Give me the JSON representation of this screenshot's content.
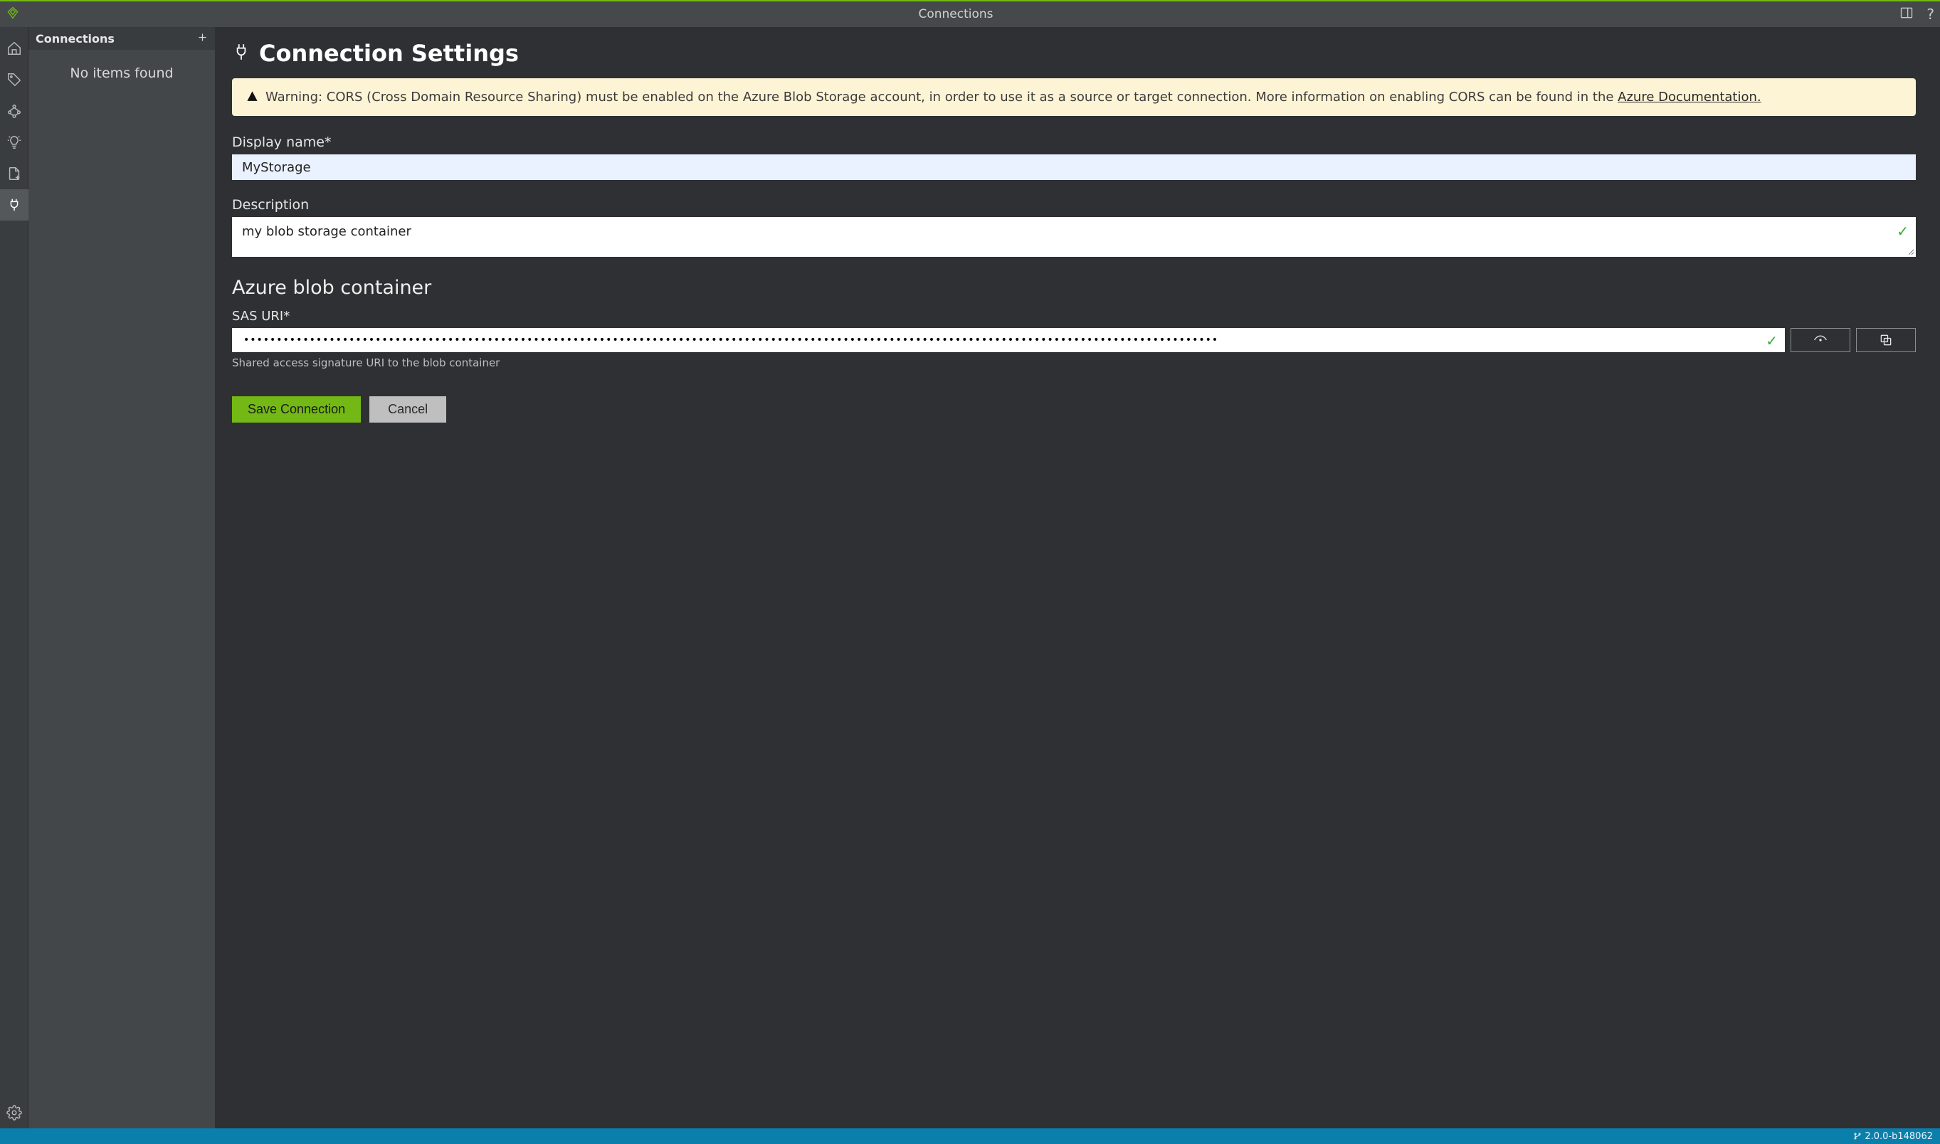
{
  "titlebar": {
    "title": "Connections"
  },
  "sidebar": {
    "header": "Connections",
    "empty_message": "No items found"
  },
  "main": {
    "page_title": "Connection Settings",
    "warning_prefix": "Warning: CORS (Cross Domain Resource Sharing) must be enabled on the Azure Blob Storage account, in order to use it as a source or target connection. More information on enabling CORS can be found in the ",
    "warning_link_text": "Azure Documentation.",
    "display_name_label": "Display name*",
    "display_name_value": "MyStorage",
    "description_label": "Description",
    "description_value": "my blob storage container",
    "section_heading": "Azure blob container",
    "sas_label": "SAS URI*",
    "sas_value": "••••••••••••••••••••••••••••••••••••••••••••••••••••••••••••••••••••••••••••••••••••••••••••••••••••••••••••••••••••••••••••••••••••••••••••••••••••",
    "sas_help": "Shared access signature URI to the blob container",
    "save_label": "Save Connection",
    "cancel_label": "Cancel"
  },
  "statusbar": {
    "version": "2.0.0-b148062"
  }
}
